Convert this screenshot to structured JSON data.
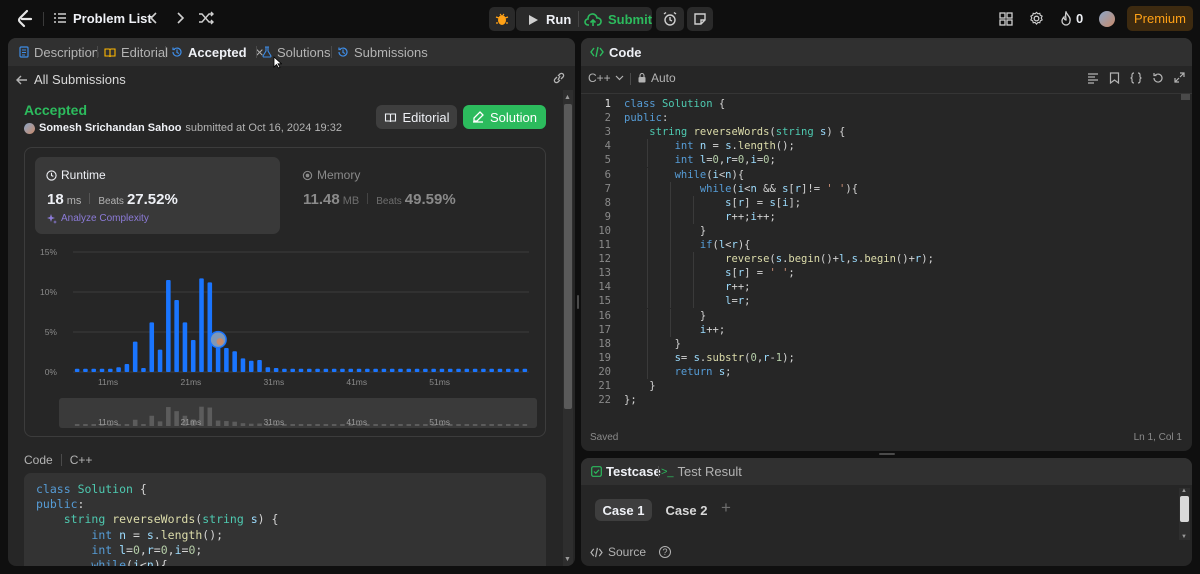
{
  "header": {
    "problem_list_label": "Problem List",
    "run_label": "Run",
    "submit_label": "Submit",
    "streak_count": "0",
    "premium_label": "Premium"
  },
  "left_tabs": [
    {
      "label": "Description"
    },
    {
      "label": "Editorial"
    },
    {
      "label": "Accepted"
    },
    {
      "label": "Solutions"
    },
    {
      "label": "Submissions"
    }
  ],
  "submission": {
    "back_label": "All Submissions",
    "status": "Accepted",
    "user": "Somesh Srichandan Sahoo",
    "submitted_at": "submitted at Oct 16, 2024 19:32",
    "editorial_button": "Editorial",
    "solution_button": "Solution",
    "runtime_title": "Runtime",
    "runtime_value": "18",
    "runtime_unit": "ms",
    "beats_label": "Beats",
    "runtime_beats": "27.52%",
    "analyze_label": "Analyze Complexity",
    "memory_title": "Memory",
    "memory_value": "11.48",
    "memory_unit": "MB",
    "memory_beats": "49.59%",
    "code_label": "Code",
    "lang_label": "C++"
  },
  "chart_data": {
    "type": "bar",
    "y_ticks": [
      "15%",
      "10%",
      "5%",
      "0%"
    ],
    "x_ticks": [
      "11ms",
      "21ms",
      "31ms",
      "41ms",
      "51ms"
    ],
    "ylim": [
      0,
      15
    ],
    "values": [
      0.4,
      0.4,
      0.4,
      0.4,
      0.4,
      0.6,
      1.0,
      3.8,
      0.5,
      6.2,
      2.8,
      11.5,
      9.0,
      6.2,
      4.0,
      11.7,
      11.2,
      3.3,
      3.0,
      2.6,
      1.7,
      1.4,
      1.5,
      0.6,
      0.5,
      0.4,
      0.4,
      0.4,
      0.4,
      0.4,
      0.4,
      0.4,
      0.4,
      0.4,
      0.4,
      0.4,
      0.4,
      0.4,
      0.4,
      0.4,
      0.4,
      0.4,
      0.4,
      0.4,
      0.4,
      0.4,
      0.4,
      0.4,
      0.4,
      0.4,
      0.4,
      0.4,
      0.4,
      0.4,
      0.4
    ],
    "highlight_index": 17,
    "bar_color": "#1a75ff"
  },
  "code_panel": {
    "title": "Code",
    "language": "C++",
    "auto_label": "Auto",
    "status_left": "Saved",
    "status_right": "Ln 1, Col 1",
    "lines": [
      "class Solution {",
      "public:",
      "    string reverseWords(string s) {",
      "        int n = s.length();",
      "        int l=0,r=0,i=0;",
      "        while(i<n){",
      "            while(i<n && s[r]!= ' '){",
      "                s[r] = s[i];",
      "                r++;i++;",
      "            }",
      "            if(l<r){",
      "                reverse(s.begin()+l,s.begin()+r);",
      "                s[r] = ' ';",
      "                r++;",
      "                l=r;",
      "            }",
      "            i++;",
      "        }",
      "        s= s.substr(0,r-1);",
      "        return s;",
      "    }",
      "};"
    ]
  },
  "bottom_panel": {
    "testcase_tab": "Testcase",
    "result_tab": "Test Result",
    "cases": [
      "Case 1",
      "Case 2"
    ],
    "source_label": "Source"
  },
  "colors": {
    "accent_green": "#2cbb5d",
    "accent_orange": "#ffa116",
    "bar_blue": "#1a75ff"
  }
}
